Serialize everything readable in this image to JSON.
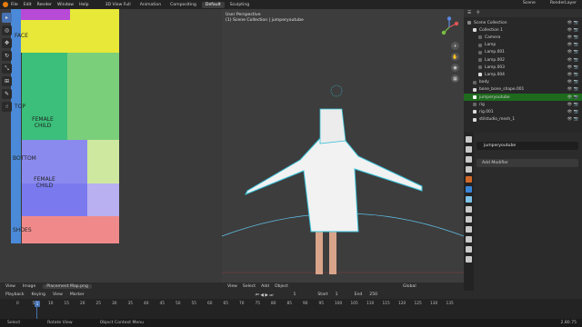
{
  "topbar": {
    "menus": [
      "File",
      "Edit",
      "Render",
      "Window",
      "Help"
    ],
    "workspaces": [
      "3D View Full",
      "Animation",
      "Compositing",
      "Default",
      "Sculpting"
    ],
    "active_workspace": "Default",
    "scene": "Scene",
    "view_layer": "RenderLayer"
  },
  "uv_editor": {
    "labels": {
      "face": "FACE",
      "top": "TOP",
      "top_text": "FEMALE CHILD",
      "bottom": "BOTTOM",
      "bottom_text": "FEMALE CHILD",
      "shoes": "SHOES"
    },
    "header": {
      "view": "View",
      "image": "Image",
      "image_name": "Placement Map.png"
    }
  },
  "viewport": {
    "info_line1": "User Perspective",
    "info_line2": "(1) Scene Collection | jumperyoutube",
    "header": [
      "View",
      "Select",
      "Add",
      "Object"
    ],
    "transform": "Global"
  },
  "outliner": {
    "rows": [
      {
        "label": "Scene Collection",
        "indent": 0,
        "color": "#888888",
        "selected": false
      },
      {
        "label": "Collection 1",
        "indent": 1,
        "color": "#dddddd",
        "selected": false
      },
      {
        "label": "Camera",
        "indent": 2,
        "color": "#666666",
        "selected": false
      },
      {
        "label": "Lamp",
        "indent": 2,
        "color": "#666666",
        "selected": false
      },
      {
        "label": "Lamp.001",
        "indent": 2,
        "color": "#666666",
        "selected": false
      },
      {
        "label": "Lamp.002",
        "indent": 2,
        "color": "#666666",
        "selected": false
      },
      {
        "label": "Lamp.003",
        "indent": 2,
        "color": "#666666",
        "selected": false
      },
      {
        "label": "Lamp.004",
        "indent": 2,
        "color": "#dddddd",
        "selected": false
      },
      {
        "label": "body",
        "indent": 1,
        "color": "#666666",
        "selected": false
      },
      {
        "label": "bone_bone_shape.001",
        "indent": 1,
        "color": "#dddddd",
        "selected": false
      },
      {
        "label": "jumperyoutube",
        "indent": 1,
        "color": "#ffffff",
        "selected": true
      },
      {
        "label": "rig",
        "indent": 1,
        "color": "#666666",
        "selected": false
      },
      {
        "label": "rig.001",
        "indent": 1,
        "color": "#dddddd",
        "selected": false
      },
      {
        "label": "stilstudio_mesh_1",
        "indent": 1,
        "color": "#dddddd",
        "selected": false
      }
    ]
  },
  "properties": {
    "object_name": "jumperyoutube",
    "add_modifier": "Add Modifier",
    "tab_colors": [
      "#c9c9c9",
      "#c9c9c9",
      "#c9c9c9",
      "#c9c9c9",
      "#d36a2a",
      "#3a85d8",
      "#7fc3e8",
      "#c9c9c9",
      "#c9c9c9",
      "#c9c9c9",
      "#c9c9c9",
      "#c9c9c9",
      "#c9c9c9"
    ]
  },
  "timeline": {
    "header": [
      "Playback",
      "Keying",
      "View",
      "Marker"
    ],
    "current_frame": "1",
    "start_label": "Start",
    "start": "1",
    "end_label": "End",
    "end": "250",
    "frame_display": "1",
    "ticks": [
      "0",
      "5",
      "10",
      "15",
      "20",
      "25",
      "30",
      "35",
      "40",
      "45",
      "50",
      "55",
      "60",
      "65",
      "70",
      "75",
      "80",
      "85",
      "90",
      "95",
      "100",
      "105",
      "110",
      "115",
      "120",
      "125",
      "130",
      "135"
    ]
  },
  "statusbar": {
    "select": "Select",
    "rotate": "Rotate View",
    "context": "Object Context Menu",
    "version": "2.80.75"
  }
}
